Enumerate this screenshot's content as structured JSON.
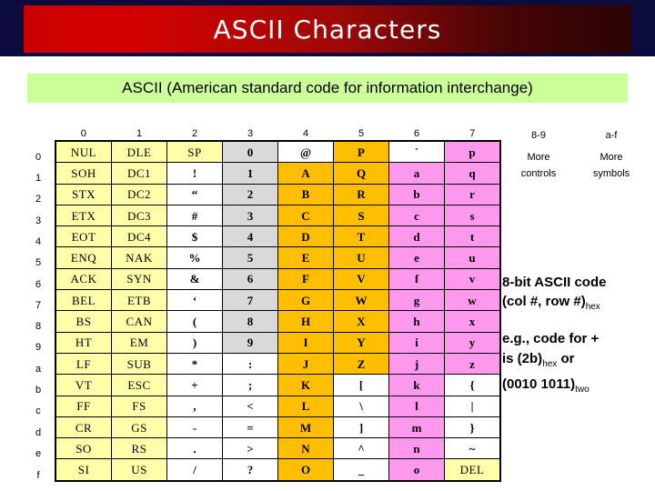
{
  "slide": {
    "title": "ASCII Characters",
    "subtitle": "ASCII (American standard code for information interchange)"
  },
  "colors": {
    "title_band_start": "#cc0000",
    "title_band_end": "#2a0303",
    "backdrop": "#0c0c3c",
    "subtitle_band": "#ccff99",
    "control_cell": "#ffffaa",
    "digit_cell": "#d9d9d9",
    "uppercase_cell": "#ffbf00",
    "lowercase_cell": "#ff99ee",
    "plain_cell": "#ffffff"
  },
  "table": {
    "column_headers": [
      "0",
      "1",
      "2",
      "3",
      "4",
      "5",
      "6",
      "7"
    ],
    "row_headers": [
      "0",
      "1",
      "2",
      "3",
      "4",
      "5",
      "6",
      "7",
      "8",
      "9",
      "a",
      "b",
      "c",
      "d",
      "e",
      "f"
    ],
    "rows": [
      [
        {
          "t": "NUL",
          "c": "yellow",
          "s": "ctrl"
        },
        {
          "t": "DLE",
          "c": "yellow",
          "s": "ctrl"
        },
        {
          "t": "SP",
          "c": "yellow",
          "s": "ctrl"
        },
        {
          "t": "0",
          "c": "gray",
          "s": "glyph"
        },
        {
          "t": "@",
          "c": "white",
          "s": "glyph"
        },
        {
          "t": "P",
          "c": "orange",
          "s": "glyph"
        },
        {
          "t": "`",
          "c": "white",
          "s": "glyph"
        },
        {
          "t": "p",
          "c": "magenta",
          "s": "glyph"
        }
      ],
      [
        {
          "t": "SOH",
          "c": "yellow",
          "s": "ctrl"
        },
        {
          "t": "DC1",
          "c": "yellow",
          "s": "ctrl"
        },
        {
          "t": "!",
          "c": "white",
          "s": "glyph"
        },
        {
          "t": "1",
          "c": "gray",
          "s": "glyph"
        },
        {
          "t": "A",
          "c": "orange",
          "s": "glyph"
        },
        {
          "t": "Q",
          "c": "orange",
          "s": "glyph"
        },
        {
          "t": "a",
          "c": "magenta",
          "s": "glyph"
        },
        {
          "t": "q",
          "c": "magenta",
          "s": "glyph"
        }
      ],
      [
        {
          "t": "STX",
          "c": "yellow",
          "s": "ctrl"
        },
        {
          "t": "DC2",
          "c": "yellow",
          "s": "ctrl"
        },
        {
          "t": "“",
          "c": "white",
          "s": "glyph"
        },
        {
          "t": "2",
          "c": "gray",
          "s": "glyph"
        },
        {
          "t": "B",
          "c": "orange",
          "s": "glyph"
        },
        {
          "t": "R",
          "c": "orange",
          "s": "glyph"
        },
        {
          "t": "b",
          "c": "magenta",
          "s": "glyph"
        },
        {
          "t": "r",
          "c": "magenta",
          "s": "glyph"
        }
      ],
      [
        {
          "t": "ETX",
          "c": "yellow",
          "s": "ctrl"
        },
        {
          "t": "DC3",
          "c": "yellow",
          "s": "ctrl"
        },
        {
          "t": "#",
          "c": "white",
          "s": "glyph"
        },
        {
          "t": "3",
          "c": "gray",
          "s": "glyph"
        },
        {
          "t": "C",
          "c": "orange",
          "s": "glyph"
        },
        {
          "t": "S",
          "c": "orange",
          "s": "glyph"
        },
        {
          "t": "c",
          "c": "magenta",
          "s": "glyph"
        },
        {
          "t": "s",
          "c": "magenta",
          "s": "glyph"
        }
      ],
      [
        {
          "t": "EOT",
          "c": "yellow",
          "s": "ctrl"
        },
        {
          "t": "DC4",
          "c": "yellow",
          "s": "ctrl"
        },
        {
          "t": "$",
          "c": "white",
          "s": "glyph"
        },
        {
          "t": "4",
          "c": "gray",
          "s": "glyph"
        },
        {
          "t": "D",
          "c": "orange",
          "s": "glyph"
        },
        {
          "t": "T",
          "c": "orange",
          "s": "glyph"
        },
        {
          "t": "d",
          "c": "magenta",
          "s": "glyph"
        },
        {
          "t": "t",
          "c": "magenta",
          "s": "glyph"
        }
      ],
      [
        {
          "t": "ENQ",
          "c": "yellow",
          "s": "ctrl"
        },
        {
          "t": "NAK",
          "c": "yellow",
          "s": "ctrl"
        },
        {
          "t": "%",
          "c": "white",
          "s": "glyph"
        },
        {
          "t": "5",
          "c": "gray",
          "s": "glyph"
        },
        {
          "t": "E",
          "c": "orange",
          "s": "glyph"
        },
        {
          "t": "U",
          "c": "orange",
          "s": "glyph"
        },
        {
          "t": "e",
          "c": "magenta",
          "s": "glyph"
        },
        {
          "t": "u",
          "c": "magenta",
          "s": "glyph"
        }
      ],
      [
        {
          "t": "ACK",
          "c": "yellow",
          "s": "ctrl"
        },
        {
          "t": "SYN",
          "c": "yellow",
          "s": "ctrl"
        },
        {
          "t": "&",
          "c": "white",
          "s": "glyph"
        },
        {
          "t": "6",
          "c": "gray",
          "s": "glyph"
        },
        {
          "t": "F",
          "c": "orange",
          "s": "glyph"
        },
        {
          "t": "V",
          "c": "orange",
          "s": "glyph"
        },
        {
          "t": "f",
          "c": "magenta",
          "s": "glyph"
        },
        {
          "t": "v",
          "c": "magenta",
          "s": "glyph"
        }
      ],
      [
        {
          "t": "BEL",
          "c": "yellow",
          "s": "ctrl"
        },
        {
          "t": "ETB",
          "c": "yellow",
          "s": "ctrl"
        },
        {
          "t": "‘",
          "c": "white",
          "s": "glyph"
        },
        {
          "t": "7",
          "c": "gray",
          "s": "glyph"
        },
        {
          "t": "G",
          "c": "orange",
          "s": "glyph"
        },
        {
          "t": "W",
          "c": "orange",
          "s": "glyph"
        },
        {
          "t": "g",
          "c": "magenta",
          "s": "glyph"
        },
        {
          "t": "w",
          "c": "magenta",
          "s": "glyph"
        }
      ],
      [
        {
          "t": "BS",
          "c": "yellow",
          "s": "ctrl"
        },
        {
          "t": "CAN",
          "c": "yellow",
          "s": "ctrl"
        },
        {
          "t": "(",
          "c": "white",
          "s": "glyph"
        },
        {
          "t": "8",
          "c": "gray",
          "s": "glyph"
        },
        {
          "t": "H",
          "c": "orange",
          "s": "glyph"
        },
        {
          "t": "X",
          "c": "orange",
          "s": "glyph"
        },
        {
          "t": "h",
          "c": "magenta",
          "s": "glyph"
        },
        {
          "t": "x",
          "c": "magenta",
          "s": "glyph"
        }
      ],
      [
        {
          "t": "HT",
          "c": "yellow",
          "s": "ctrl"
        },
        {
          "t": "EM",
          "c": "yellow",
          "s": "ctrl"
        },
        {
          "t": ")",
          "c": "white",
          "s": "glyph"
        },
        {
          "t": "9",
          "c": "gray",
          "s": "glyph"
        },
        {
          "t": "I",
          "c": "orange",
          "s": "glyph"
        },
        {
          "t": "Y",
          "c": "orange",
          "s": "glyph"
        },
        {
          "t": "i",
          "c": "magenta",
          "s": "glyph"
        },
        {
          "t": "y",
          "c": "magenta",
          "s": "glyph"
        }
      ],
      [
        {
          "t": "LF",
          "c": "yellow",
          "s": "ctrl"
        },
        {
          "t": "SUB",
          "c": "yellow",
          "s": "ctrl"
        },
        {
          "t": "*",
          "c": "white",
          "s": "glyph"
        },
        {
          "t": ":",
          "c": "white",
          "s": "glyph"
        },
        {
          "t": "J",
          "c": "orange",
          "s": "glyph"
        },
        {
          "t": "Z",
          "c": "orange",
          "s": "glyph"
        },
        {
          "t": "j",
          "c": "magenta",
          "s": "glyph"
        },
        {
          "t": "z",
          "c": "magenta",
          "s": "glyph"
        }
      ],
      [
        {
          "t": "VT",
          "c": "yellow",
          "s": "ctrl"
        },
        {
          "t": "ESC",
          "c": "yellow",
          "s": "ctrl"
        },
        {
          "t": "+",
          "c": "white",
          "s": "glyph"
        },
        {
          "t": ";",
          "c": "white",
          "s": "glyph"
        },
        {
          "t": "K",
          "c": "orange",
          "s": "glyph"
        },
        {
          "t": "[",
          "c": "white",
          "s": "glyph"
        },
        {
          "t": "k",
          "c": "magenta",
          "s": "glyph"
        },
        {
          "t": "{",
          "c": "white",
          "s": "glyph"
        }
      ],
      [
        {
          "t": "FF",
          "c": "yellow",
          "s": "ctrl"
        },
        {
          "t": "FS",
          "c": "yellow",
          "s": "ctrl"
        },
        {
          "t": ",",
          "c": "white",
          "s": "glyph"
        },
        {
          "t": "<",
          "c": "white",
          "s": "glyph"
        },
        {
          "t": "L",
          "c": "orange",
          "s": "glyph"
        },
        {
          "t": "\\",
          "c": "white",
          "s": "glyph"
        },
        {
          "t": "l",
          "c": "magenta",
          "s": "glyph"
        },
        {
          "t": "|",
          "c": "white",
          "s": "glyph"
        }
      ],
      [
        {
          "t": "CR",
          "c": "yellow",
          "s": "ctrl"
        },
        {
          "t": "GS",
          "c": "yellow",
          "s": "ctrl"
        },
        {
          "t": "-",
          "c": "white",
          "s": "glyph"
        },
        {
          "t": "=",
          "c": "white",
          "s": "glyph"
        },
        {
          "t": "M",
          "c": "orange",
          "s": "glyph"
        },
        {
          "t": "]",
          "c": "white",
          "s": "glyph"
        },
        {
          "t": "m",
          "c": "magenta",
          "s": "glyph"
        },
        {
          "t": "}",
          "c": "white",
          "s": "glyph"
        }
      ],
      [
        {
          "t": "SO",
          "c": "yellow",
          "s": "ctrl"
        },
        {
          "t": "RS",
          "c": "yellow",
          "s": "ctrl"
        },
        {
          "t": ".",
          "c": "white",
          "s": "glyph"
        },
        {
          "t": ">",
          "c": "white",
          "s": "glyph"
        },
        {
          "t": "N",
          "c": "orange",
          "s": "glyph"
        },
        {
          "t": "^",
          "c": "white",
          "s": "glyph"
        },
        {
          "t": "n",
          "c": "magenta",
          "s": "glyph"
        },
        {
          "t": "~",
          "c": "white",
          "s": "glyph"
        }
      ],
      [
        {
          "t": "SI",
          "c": "yellow",
          "s": "ctrl"
        },
        {
          "t": "US",
          "c": "yellow",
          "s": "ctrl"
        },
        {
          "t": "/",
          "c": "white",
          "s": "glyph"
        },
        {
          "t": "?",
          "c": "white",
          "s": "glyph"
        },
        {
          "t": "O",
          "c": "orange",
          "s": "glyph"
        },
        {
          "t": "_",
          "c": "white",
          "s": "glyph"
        },
        {
          "t": "o",
          "c": "magenta",
          "s": "glyph"
        },
        {
          "t": "DEL",
          "c": "yellow",
          "s": "ctrl"
        }
      ]
    ]
  },
  "legend": {
    "columns": [
      {
        "range": "8-9",
        "line1": "More",
        "line2": "controls"
      },
      {
        "range": "a-f",
        "line1": "More",
        "line2": "symbols"
      }
    ]
  },
  "notes": {
    "code_line1": "8-bit ASCII code",
    "code_line2_main": "(col #, row #)",
    "code_line2_sub": "hex",
    "example_line1": "e.g., code for +",
    "example_line2_a": "is (2b)",
    "example_line2_sub": "hex",
    "example_line2_b": " or",
    "example_line3_main": "(0010 1011)",
    "example_line3_sub": "two"
  }
}
